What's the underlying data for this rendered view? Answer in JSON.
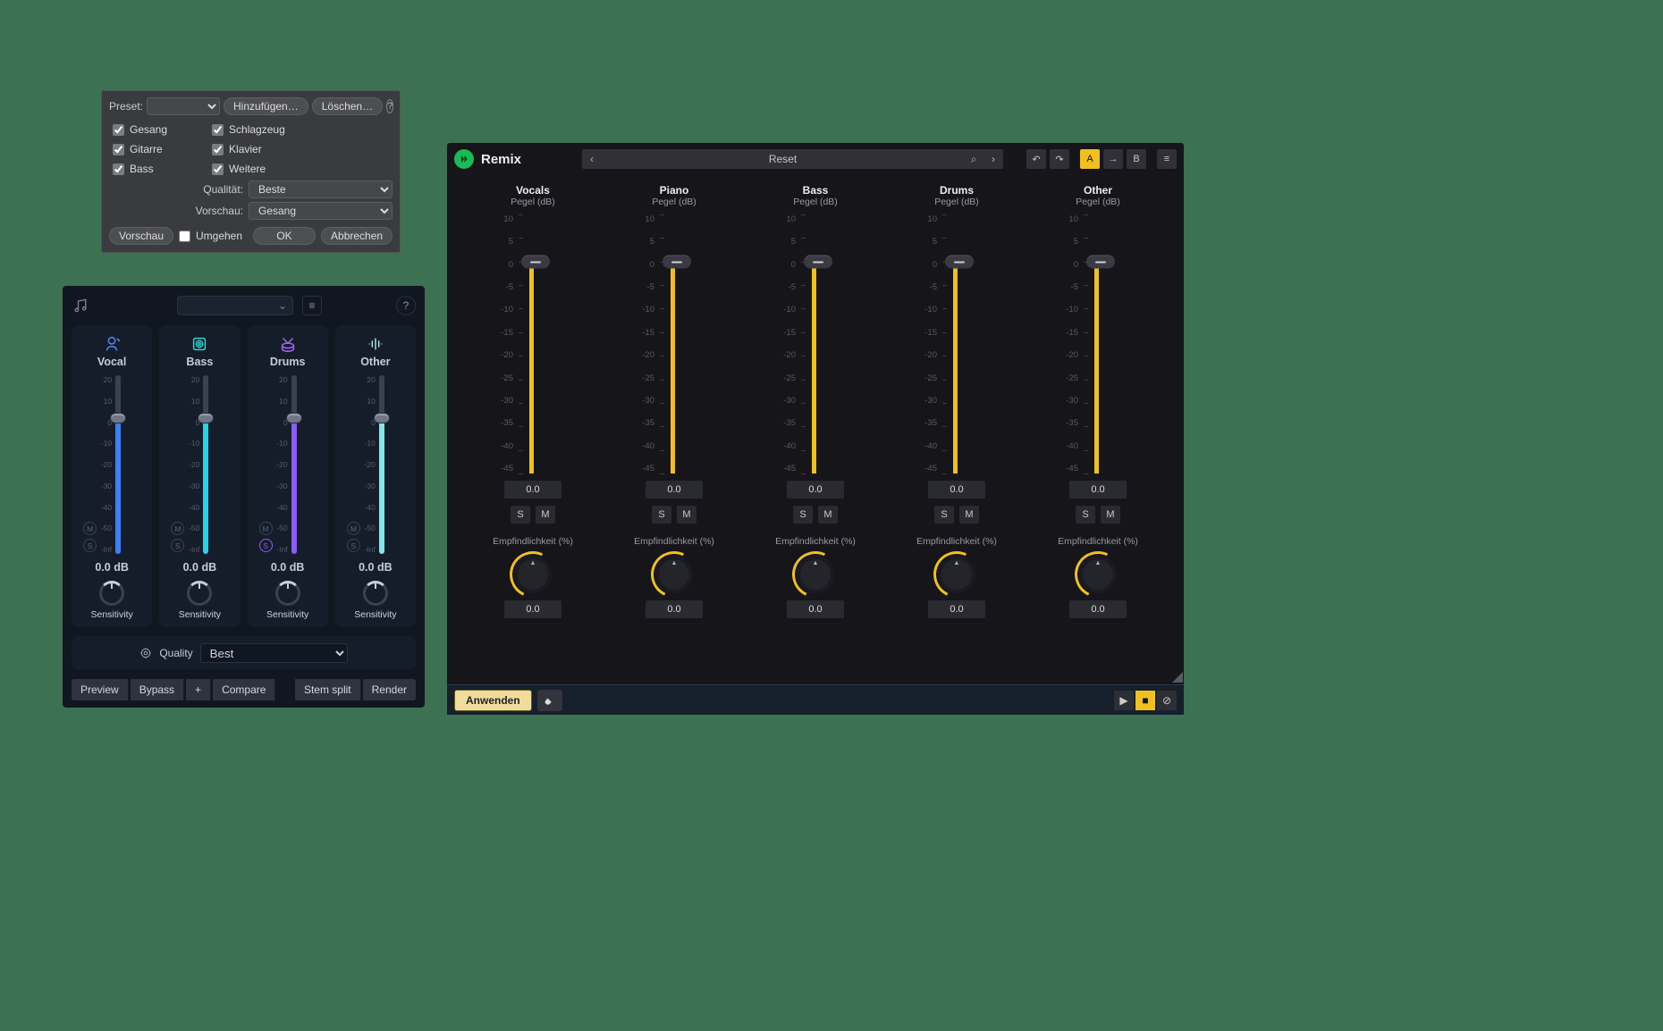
{
  "panel1": {
    "preset_label": "Preset:",
    "add": "Hinzufügen…",
    "delete": "Löschen…",
    "checks_left": [
      "Gesang",
      "Gitarre",
      "Bass"
    ],
    "checks_right": [
      "Schlagzeug",
      "Klavier",
      "Weitere"
    ],
    "quality_label": "Qualität:",
    "quality_value": "Beste",
    "preview_label": "Vorschau:",
    "preview_value": "Gesang",
    "btn_preview": "Vorschau",
    "bypass": "Umgehen",
    "ok": "OK",
    "cancel": "Abbrechen"
  },
  "panel2": {
    "channels": [
      {
        "name": "Vocal",
        "color": "blue",
        "icon": "vocal"
      },
      {
        "name": "Bass",
        "color": "cyan",
        "icon": "bass"
      },
      {
        "name": "Drums",
        "color": "purple",
        "icon": "drums"
      },
      {
        "name": "Other",
        "color": "teal",
        "icon": "other"
      }
    ],
    "scale": [
      "20",
      "10",
      "0",
      "-10",
      "-20",
      "-30",
      "-40",
      "-50",
      "-Inf"
    ],
    "value": "0.0 dB",
    "sensitivity": "Sensitivity",
    "quality_label": "Quality",
    "quality_value": "Best",
    "footer": {
      "preview": "Preview",
      "bypass": "Bypass",
      "plus": "+",
      "compare": "Compare",
      "stemsplit": "Stem split",
      "render": "Render"
    }
  },
  "panel3": {
    "title": "Remix",
    "reset": "Reset",
    "ab": {
      "a": "A",
      "b": "B"
    },
    "channels": [
      "Vocals",
      "Piano",
      "Bass",
      "Drums",
      "Other"
    ],
    "subtitle": "Pegel (dB)",
    "scale": [
      "10",
      "5",
      "0",
      "-5",
      "-10",
      "-15",
      "-20",
      "-25",
      "-30",
      "-35",
      "-40",
      "-45"
    ],
    "value": "0.0",
    "s": "S",
    "m": "M",
    "sensitivity": "Empfindlichkeit (%)",
    "apply": "Anwenden"
  }
}
